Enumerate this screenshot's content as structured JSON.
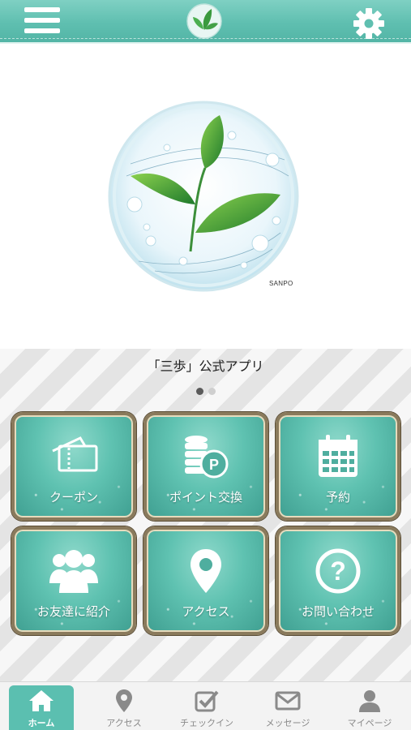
{
  "header": {
    "menu_icon": "hamburger-menu-icon",
    "settings_icon": "gear-icon",
    "logo_icon": "leaf-logo-icon"
  },
  "hero": {
    "logo_icon": "leaf-bubble-logo",
    "logo_text": "SANPO"
  },
  "caption": "「三歩」公式アプリ",
  "pager": {
    "pages": 2,
    "current": 1
  },
  "tiles": [
    {
      "label": "クーポン",
      "icon": "coupon-ticket-icon"
    },
    {
      "label": "ポイント交換",
      "icon": "coin-point-icon"
    },
    {
      "label": "予約",
      "icon": "calendar-icon"
    },
    {
      "label": "お友達に紹介",
      "icon": "users-group-icon"
    },
    {
      "label": "アクセス",
      "icon": "map-pin-icon"
    },
    {
      "label": "お問い合わせ",
      "icon": "question-circle-icon"
    }
  ],
  "tabbar": [
    {
      "label": "ホーム",
      "icon": "home-icon",
      "active": true
    },
    {
      "label": "アクセス",
      "icon": "map-pin-icon",
      "active": false
    },
    {
      "label": "チェックイン",
      "icon": "checkin-icon",
      "active": false
    },
    {
      "label": "メッセージ",
      "icon": "envelope-icon",
      "active": false
    },
    {
      "label": "マイページ",
      "icon": "user-icon",
      "active": false
    }
  ],
  "colors": {
    "accent": "#5bbfb0",
    "tile_frame": "#8a7a5c",
    "tab_inactive": "#8a8a8a"
  }
}
